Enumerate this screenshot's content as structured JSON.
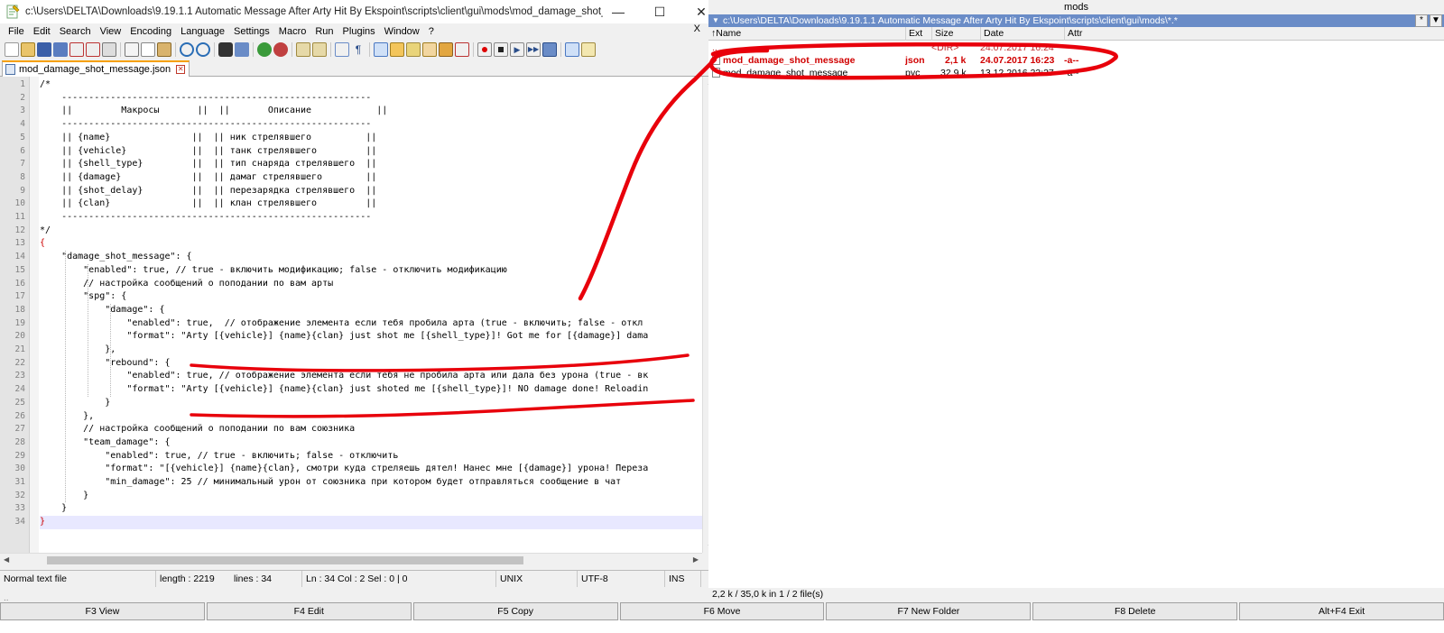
{
  "npp": {
    "title": "c:\\Users\\DELTA\\Downloads\\9.19.1.1 Automatic Message After Arty Hit By Ekspoint\\scripts\\client\\gui\\mods\\mod_damage_shot_message.json - No...",
    "window_controls": {
      "minimize": "—",
      "maximize": "☐",
      "close": "✕"
    },
    "menu": [
      "File",
      "Edit",
      "Search",
      "View",
      "Encoding",
      "Language",
      "Settings",
      "Macro",
      "Run",
      "Plugins",
      "Window",
      "?"
    ],
    "menu_close": "X",
    "tab_label": "mod_damage_shot_message.json",
    "code_lines": [
      "/*",
      "    ---------------------------------------------------------",
      "    ||         Макросы       ||  ||       Описание            ||",
      "    ---------------------------------------------------------",
      "    || {name}               ||  || ник стрелявшего          ||",
      "    || {vehicle}            ||  || танк стрелявшего         ||",
      "    || {shell_type}         ||  || тип снаряда стрелявшего  ||",
      "    || {damage}             ||  || дамаг стрелявшего        ||",
      "    || {shot_delay}         ||  || перезарядка стрелявшего  ||",
      "    || {clan}               ||  || клан стрелявшего         ||",
      "    ---------------------------------------------------------",
      "*/",
      "{",
      "    \"damage_shot_message\": {",
      "        \"enabled\": true, // true - включить модификацию; false - отключить модификацию",
      "        // настройка сообщений о поподании по вам арты",
      "        \"spg\": {",
      "            \"damage\": {",
      "                \"enabled\": true,  // отображение элемента если тебя пробила арта (true - включить; false - откл",
      "                \"format\": \"Arty [{vehicle}] {name}{clan} just shot me [{shell_type}]! Got me for [{damage}] dama",
      "            },",
      "            \"rebound\": {",
      "                \"enabled\": true, // отображение элемента если тебя не пробила арта или дала без урона (true - вк",
      "                \"format\": \"Arty [{vehicle}] {name}{clan} just shoted me [{shell_type}]! NO damage done! Reloadin",
      "            }",
      "        },",
      "        // настройка сообщений о поподании по вам союзника",
      "        \"team_damage\": {",
      "            \"enabled\": true, // true - включить; false - отключить",
      "            \"format\": \"[{vehicle}] {name}{clan}, смотри куда стреляешь дятел! Нанес мне [{damage}] урона! Переза",
      "            \"min_damage\": 25 // минимальный урон от союзника при котором будет отправляться сообщение в чат",
      "        }",
      "    }",
      "}"
    ],
    "line_numbers": [
      "1",
      "2",
      "3",
      "4",
      "5",
      "6",
      "7",
      "8",
      "9",
      "10",
      "11",
      "12",
      "13",
      "14",
      "15",
      "16",
      "17",
      "18",
      "19",
      "20",
      "21",
      "22",
      "23",
      "24",
      "25",
      "26",
      "27",
      "28",
      "29",
      "30",
      "31",
      "32",
      "33",
      "34"
    ],
    "status": {
      "file_type": "Normal text file",
      "length": "length : 2219",
      "lines": "lines : 34",
      "position": "Ln : 34    Col : 2    Sel : 0 | 0",
      "eol": "UNIX",
      "encoding": "UTF-8",
      "mode": "INS"
    }
  },
  "tc": {
    "top_label": "mods",
    "path": "c:\\Users\\DELTA\\Downloads\\9.19.1.1 Automatic Message After Arty Hit By Ekspoint\\scripts\\client\\gui\\mods\\*.*",
    "path_btns": [
      "*",
      "▼"
    ],
    "columns": [
      "↑Name",
      "Ext",
      "Size",
      "Date",
      "Attr"
    ],
    "rows": [
      {
        "name": "..",
        "ext": "",
        "size": "<DIR>",
        "date": "24.07.2017 16:24",
        "attr": ""
      },
      {
        "name": "mod_damage_shot_message",
        "ext": "json",
        "size": "2,1 k",
        "date": "24.07.2017 16:23",
        "attr": "-a--"
      },
      {
        "name": "mod_damage_shot_message",
        "ext": "pyc",
        "size": "32,9 k",
        "date": "13.12.2016 22:37",
        "attr": "-a--"
      }
    ],
    "info": "2,2 k / 35,0 k in 1 / 2 file(s)"
  },
  "fkeys": [
    "F3 View",
    "F4 Edit",
    "F5 Copy",
    "F6 Move",
    "F7 New Folder",
    "F8 Delete",
    "Alt+F4 Exit"
  ],
  "colors": {
    "annotation": "#e8000b",
    "path_bar": "#6a8cc7",
    "selected_file": "#d00000"
  },
  "icons": [
    "notepadpp-icon",
    "new-icon",
    "open-icon",
    "save-icon",
    "save-all-icon",
    "close-icon",
    "close-all-icon",
    "print-icon",
    "cut-icon",
    "copy-icon",
    "paste-icon",
    "undo-icon",
    "redo-icon",
    "find-icon",
    "replace-icon",
    "zoom-in-icon",
    "zoom-out-icon",
    "sync-v-icon",
    "sync-h-icon",
    "word-wrap-icon",
    "all-chars-icon",
    "indent-guide-icon",
    "udl-icon",
    "doc-map-icon",
    "function-list-icon",
    "folder-workspace-icon",
    "monitor-icon",
    "record-macro-icon",
    "stop-macro-icon",
    "play-macro-icon",
    "run-macro-multiple-icon",
    "save-macro-icon",
    "spellcheck-icon",
    "spellcheck-options-icon"
  ]
}
